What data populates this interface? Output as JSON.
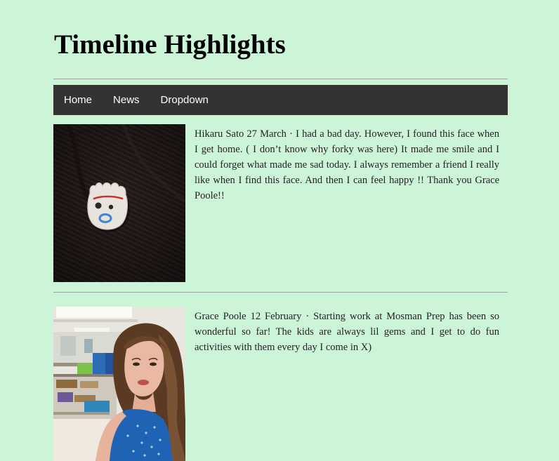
{
  "site": {
    "title": "Timeline Highlights"
  },
  "nav": {
    "items": [
      {
        "label": "Home"
      },
      {
        "label": "News"
      },
      {
        "label": "Dropdown"
      }
    ]
  },
  "posts": [
    {
      "text": "Hikaru Sato 27 March · I had a bad day. However, I found this face when I get home. ( I don’t know why forky was here) It made me smile and I could forget what made me sad today. I always remember a friend I really like when I find this face. And then I can feel happy !! Thank you Grace Poole!!",
      "image": "forky-pin-photo"
    },
    {
      "text": "Grace Poole 12 February · Starting work at Mosman Prep has been so wonderful so far! The kids are always lil gems and I get to do fun activities with them every day I come in X)",
      "image": "classroom-selfie-photo"
    }
  ],
  "colors": {
    "background": "#ccf5d8",
    "navbar": "#333333",
    "nav_text": "#ffffff"
  }
}
